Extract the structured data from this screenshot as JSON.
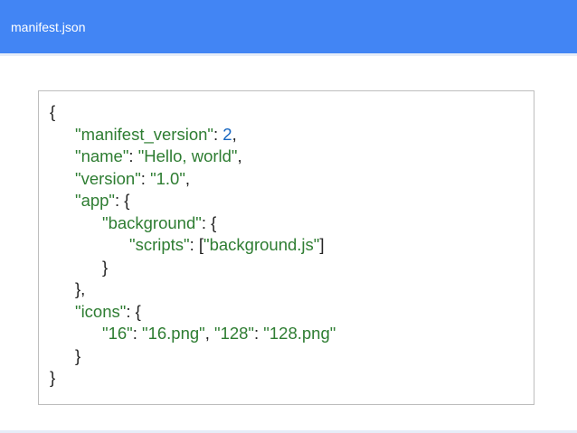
{
  "header": {
    "title": "manifest.json"
  },
  "colors": {
    "header_bg": "#4285f4",
    "string": "#2e7d32",
    "number": "#1565c0",
    "punctuation": "#212121"
  },
  "code": {
    "l1": {
      "brace": "{"
    },
    "l2": {
      "key": "\"manifest_version\"",
      "sep": ": ",
      "value": "2",
      "end": ","
    },
    "l3": {
      "key": "\"name\"",
      "sep": ": ",
      "value": "\"Hello, world\"",
      "end": ","
    },
    "l4": {
      "key": "\"version\"",
      "sep": ": ",
      "value": "\"1.0\"",
      "end": ","
    },
    "l5": {
      "key": "\"app\"",
      "sep": ": {"
    },
    "l6": {
      "key": "\"background\"",
      "sep": ": {"
    },
    "l7": {
      "key": "\"scripts\"",
      "sep": ": [",
      "value": "\"background.js\"",
      "end": "]"
    },
    "l8": {
      "brace": "}"
    },
    "l9": {
      "brace": "},"
    },
    "l10": {
      "key": "\"icons\"",
      "sep": ": {"
    },
    "l11": {
      "key1": "\"16\"",
      "sep1": ": ",
      "value1": "\"16.png\"",
      "mid": ", ",
      "key2": "\"128\"",
      "sep2": ": ",
      "value2": "\"128.png\""
    },
    "l12": {
      "brace": "}"
    },
    "l13": {
      "brace": "}"
    }
  }
}
